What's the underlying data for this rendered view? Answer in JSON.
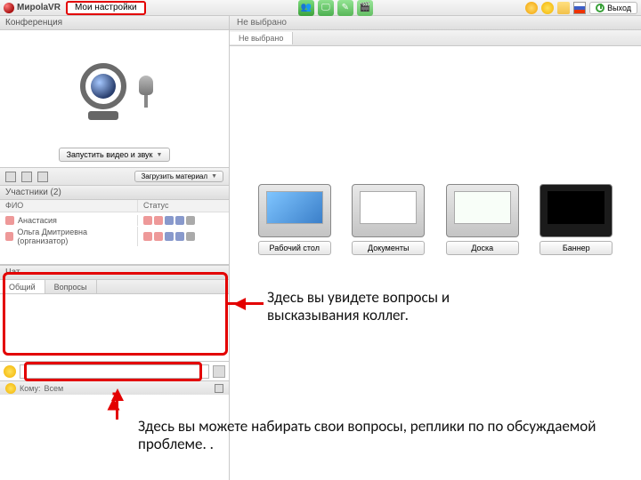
{
  "brand": "MирolaVR",
  "header": {
    "settings_tab": "Мои настройки",
    "exit_label": "Выход"
  },
  "leftcol": {
    "conference": {
      "title": "Конференция",
      "av_button": "Запустить видео и звук"
    },
    "toolbar_button": "Загрузить материал",
    "participants": {
      "title": "Участники (2)",
      "col_name": "ФИО",
      "col_status": "Статус",
      "rows": [
        {
          "name": "Анастасия"
        },
        {
          "name": "Ольга Дмитриевна (организатор)"
        }
      ]
    },
    "chat": {
      "title": "Чат",
      "tabs": {
        "common": "Общий",
        "questions": "Вопросы"
      },
      "to_label": "Кому:",
      "to_value": "Всем"
    }
  },
  "rightcol": {
    "not_selected": "Не выбрано",
    "tab_not_selected": "Не выбрано",
    "tiles": {
      "desktop": "Рабочий стол",
      "documents": "Документы",
      "board": "Доска",
      "banner": "Баннер"
    }
  },
  "annotations": {
    "chat_view": "Здесь вы увидете вопросы и высказывания коллег.",
    "chat_input": "Здесь вы можете набирать свои вопросы, реплики по по обсуждаемой проблеме. ."
  }
}
